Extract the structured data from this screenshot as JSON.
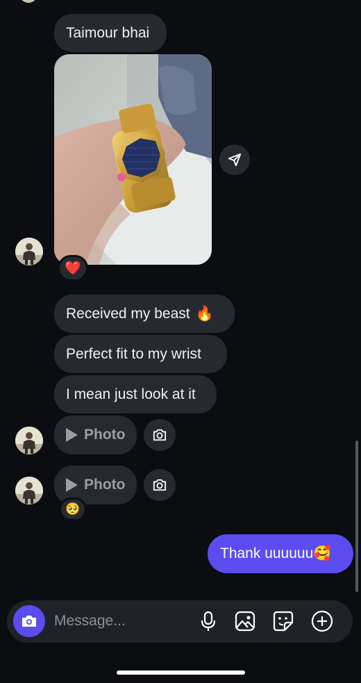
{
  "messages": {
    "m1": "Taimour bhai",
    "m2": "Received my beast",
    "m2_emoji": "🔥",
    "m3": "Perfect fit to my wrist",
    "m4": "I mean just look at it"
  },
  "media": {
    "photo1_label": "Photo",
    "photo2_label": "Photo"
  },
  "reactions": {
    "image_reaction": "❤️",
    "photo2_reaction": "🥺"
  },
  "sent": {
    "text": "Thank uuuuuu🥰"
  },
  "composer": {
    "placeholder": "Message..."
  },
  "colors": {
    "background": "#0b0d11",
    "bubble_incoming": "#262a30",
    "bubble_outgoing": "#5b4cf0",
    "accent": "#5b4cf0"
  },
  "icons": [
    "send-icon",
    "camera-icon",
    "microphone-icon",
    "gallery-icon",
    "sticker-icon",
    "plus-icon",
    "play-icon"
  ]
}
